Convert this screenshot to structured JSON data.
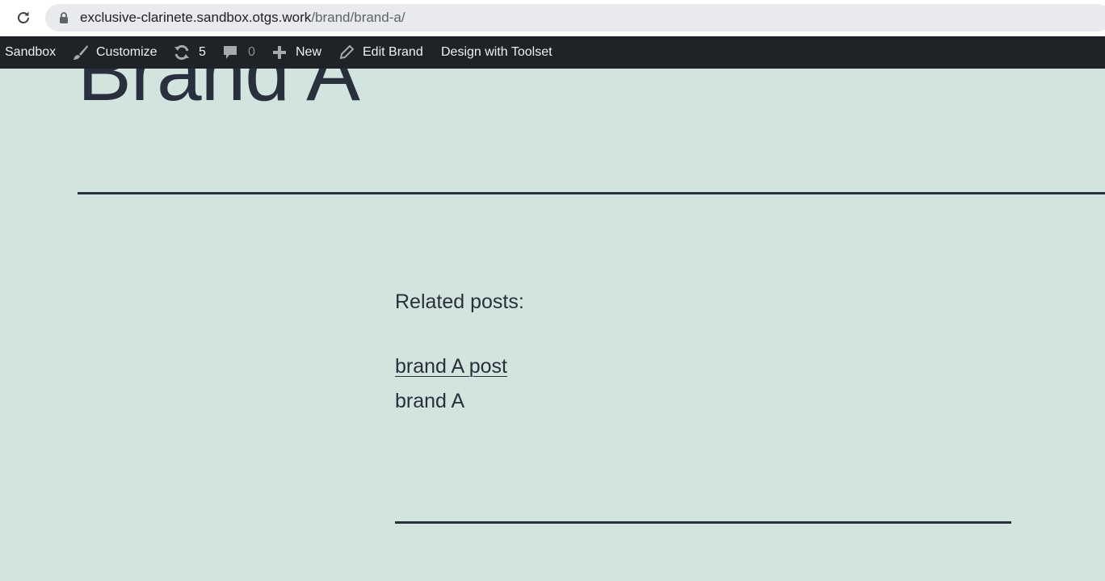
{
  "browser": {
    "url_host": "exclusive-clarinete.sandbox.otgs.work",
    "url_path": "/brand/brand-a/"
  },
  "adminbar": {
    "site": "Sandbox",
    "customize": "Customize",
    "updates_count": "5",
    "comments_count": "0",
    "new": "New",
    "edit": "Edit Brand",
    "toolset": "Design with Toolset"
  },
  "page": {
    "title": "Brand A",
    "related_label": "Related posts:",
    "related_link": "brand A post",
    "related_text": "brand A"
  },
  "colors": {
    "background": "#d1e4dd",
    "text": "#28303d",
    "adminbar": "#1d2327"
  }
}
